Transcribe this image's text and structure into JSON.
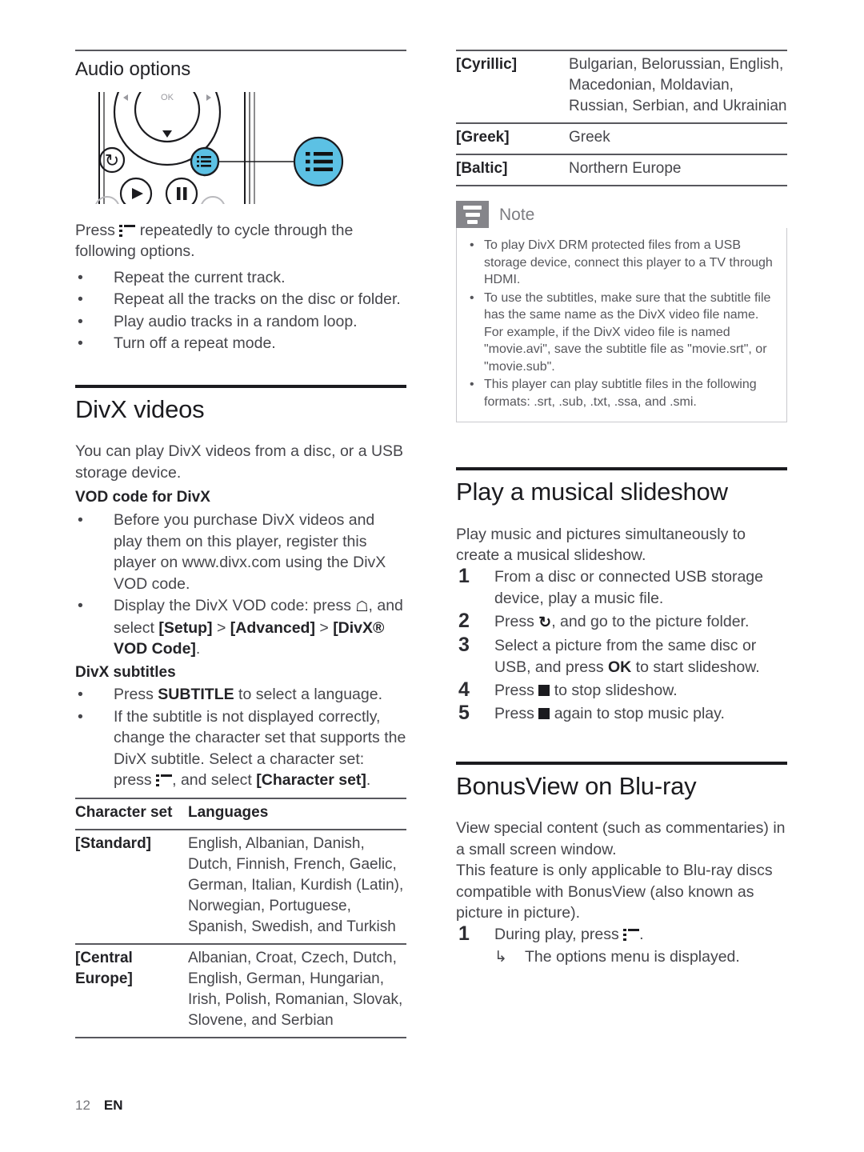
{
  "page": {
    "number": "12",
    "language": "EN"
  },
  "left": {
    "audio_options": {
      "title": "Audio options",
      "figure": {
        "name": "remote-control-options-button",
        "callout_color": "#5cc1e4",
        "labels": [
          "OK"
        ]
      },
      "intro_line1": "Press",
      "intro_icon": "options-icon",
      "intro_line2": "repeatedly to cycle through the following options.",
      "bullets": [
        "Repeat the current track.",
        "Repeat all the tracks on the disc or folder.",
        "Play audio tracks in a random loop.",
        "Turn off a repeat mode."
      ]
    },
    "divx": {
      "title": "DivX videos",
      "intro": "You can play DivX videos from a disc, or a USB storage device.",
      "vod": {
        "heading": "VOD code for DivX",
        "bullet1": "Before you purchase DivX videos and play them on this player, register this player on www.divx.com using the DivX VOD code.",
        "bullet2_a": "Display the DivX VOD code: press",
        "bullet2_icon": "home-icon",
        "bullet2_b": ", and select",
        "bullet2_menu1": "[Setup]",
        "bullet2_sep1": ">",
        "bullet2_menu2": "[Advanced]",
        "bullet2_sep2": ">",
        "bullet2_menu3": "[DivX® VOD Code]",
        "bullet2_end": "."
      },
      "subtitles": {
        "heading": "DivX subtitles",
        "bullet1_a": "Press",
        "bullet1_key": "SUBTITLE",
        "bullet1_b": "to select a language.",
        "bullet2_a": "If the subtitle is not displayed correctly, change the character set that supports the DivX subtitle. Select a character set: press",
        "bullet2_icon": "options-icon",
        "bullet2_b": ", and select",
        "bullet2_menu": "[Character set]",
        "bullet2_end": "."
      },
      "charset_table": {
        "headers": [
          "Character set",
          "Languages"
        ],
        "rows": [
          {
            "set": "[Standard]",
            "languages": "English, Albanian, Danish, Dutch, Finnish, French, Gaelic, German, Italian, Kurdish (Latin), Norwegian, Portuguese, Spanish, Swedish, and Turkish"
          },
          {
            "set": "[Central Europe]",
            "languages": "Albanian, Croat, Czech, Dutch, English, German, Hungarian, Irish, Polish, Romanian, Slovak, Slovene, and Serbian"
          }
        ]
      }
    }
  },
  "right": {
    "charset_table_cont": {
      "rows": [
        {
          "set": "[Cyrillic]",
          "languages": "Bulgarian, Belorussian, English, Macedonian, Moldavian, Russian, Serbian, and Ukrainian"
        },
        {
          "set": "[Greek]",
          "languages": "Greek"
        },
        {
          "set": "[Baltic]",
          "languages": "Northern Europe"
        }
      ]
    },
    "note": {
      "title": "Note",
      "icon": "note-lines-icon",
      "chip_color": "#85858a",
      "items": [
        "To play DivX DRM protected files from a USB storage device, connect this player to a TV through HDMI.",
        "To use the subtitles, make sure that the subtitle file has the same name as the DivX video file name. For example, if the DivX video file is named \"movie.avi\", save the subtitle file as \"movie.srt\", or \"movie.sub\".",
        "This player can play subtitle files in the following formats: .srt, .sub, .txt, .ssa, and .smi."
      ]
    },
    "slideshow": {
      "title": "Play a musical slideshow",
      "intro": "Play music and pictures simultaneously to create a musical slideshow.",
      "steps": [
        {
          "num": "1",
          "text_a": "From a disc or connected USB storage device, play a music file.",
          "icon": "",
          "text_b": ""
        },
        {
          "num": "2",
          "text_a": "Press",
          "icon": "back-icon",
          "text_b": ", and go to the picture folder."
        },
        {
          "num": "3",
          "text_a": "Select a picture from the same disc or USB, and press",
          "icon": "ok-key",
          "text_b": "to start slideshow."
        },
        {
          "num": "4",
          "text_a": "Press",
          "icon": "stop-icon",
          "text_b": "to stop slideshow."
        },
        {
          "num": "5",
          "text_a": "Press",
          "icon": "stop-icon",
          "text_b": "again to stop music play."
        }
      ],
      "ok_label": "OK"
    },
    "bonusview": {
      "title": "BonusView on Blu-ray",
      "para1": "View special content (such as commentaries) in a small screen window.",
      "para2": "This feature is only applicable to Blu-ray discs compatible with BonusView (also known as picture in picture).",
      "step1_num": "1",
      "step1_a": "During play, press",
      "step1_icon": "options-icon",
      "step1_end": ".",
      "substep_arrow": "↳",
      "substep_text": "The options menu is displayed."
    }
  }
}
